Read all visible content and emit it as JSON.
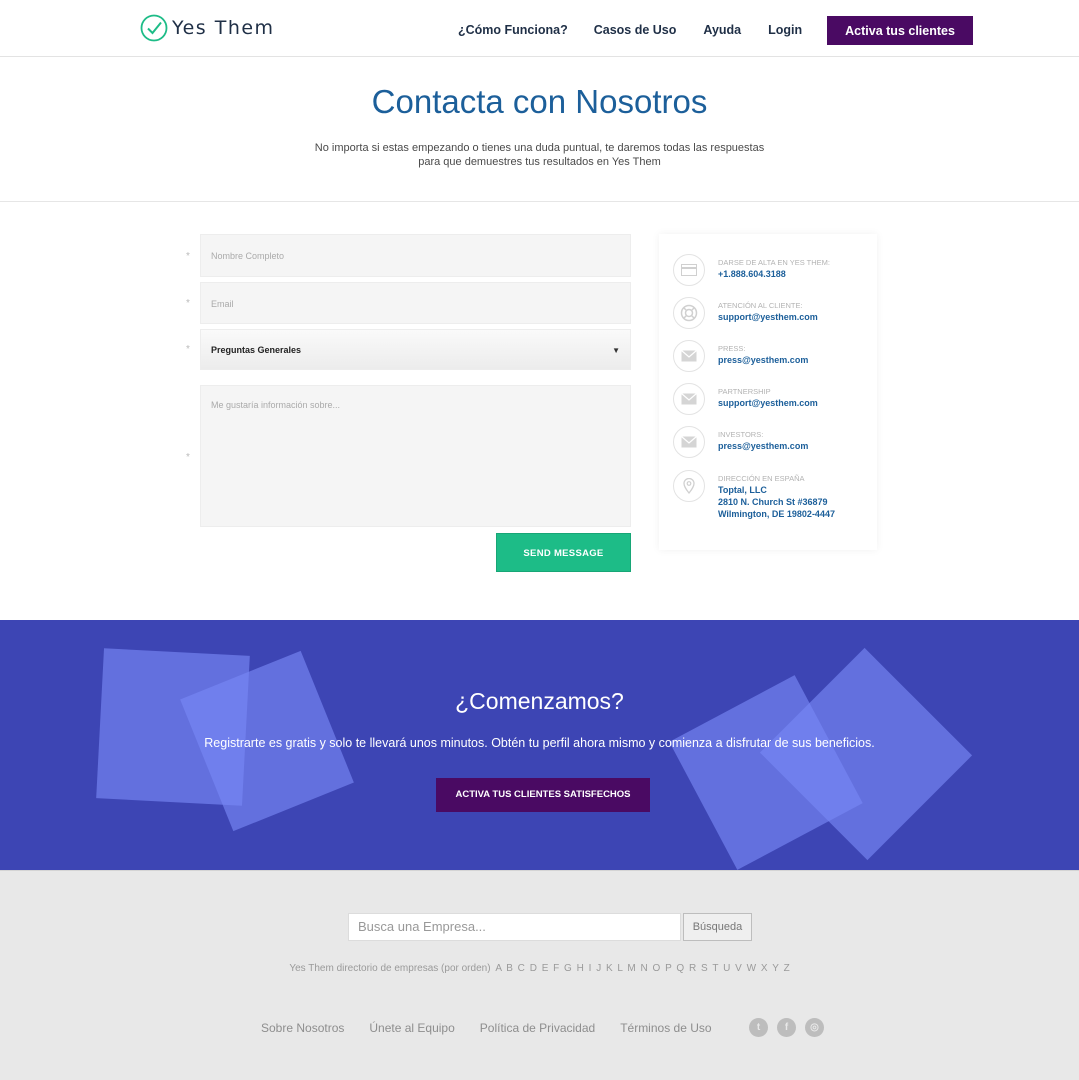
{
  "header": {
    "brand": "Yes Them",
    "nav": {
      "how": "¿Cómo Funciona?",
      "cases": "Casos de Uso",
      "help": "Ayuda",
      "login": "Login",
      "cta": "Activa tus clientes"
    }
  },
  "intro": {
    "title": "Contacta con Nosotros",
    "line1": "No importa si estas empezando o tienes una duda puntual, te daremos todas las respuestas",
    "line2": "para que demuestres tus resultados en Yes Them"
  },
  "form": {
    "required_mark": "*",
    "name_placeholder": "Nombre Completo",
    "email_placeholder": "Email",
    "topic_value": "Preguntas Generales",
    "message_placeholder": "Me gustaría información sobre...",
    "send_label": "SEND MESSAGE"
  },
  "contact": [
    {
      "icon": "card-icon",
      "label": "DARSE DE ALTA EN YES THEM:",
      "value": "+1.888.604.3188"
    },
    {
      "icon": "lifebuoy-icon",
      "label": "ATENCIÓN AL CLIENTE:",
      "value": "support@yesthem.com"
    },
    {
      "icon": "mail-icon",
      "label": "PRESS:",
      "value": "press@yesthem.com"
    },
    {
      "icon": "mail-icon",
      "label": "PARTNERSHIP",
      "value": "support@yesthem.com"
    },
    {
      "icon": "mail-icon",
      "label": "INVESTORS:",
      "value": "press@yesthem.com"
    },
    {
      "icon": "location-pin-icon",
      "label": "DIRECCIÓN EN ESPAÑA",
      "value_lines": [
        "Toptal, LLC",
        "2810 N. Church St #36879",
        "Wilmington, DE 19802-4447"
      ]
    }
  ],
  "cta": {
    "title": "¿Comenzamos?",
    "subtitle": "Registrarte es gratis y solo te llevará unos minutos. Obtén tu perfil ahora mismo y comienza a disfrutar de sus beneficios.",
    "button": "ACTIVA TUS CLIENTES SATISFECHOS"
  },
  "footer": {
    "search_placeholder": "Busca una Empresa...",
    "search_button": "Búsqueda",
    "directory_label": "Yes Them directorio de empresas (por orden)",
    "letters": [
      "A",
      "B",
      "C",
      "D",
      "E",
      "F",
      "G",
      "H",
      "I",
      "J",
      "K",
      "L",
      "M",
      "N",
      "O",
      "P",
      "Q",
      "R",
      "S",
      "T",
      "U",
      "V",
      "W",
      "X",
      "Y",
      "Z"
    ],
    "links": [
      "Sobre Nosotros",
      "Únete al Equipo",
      "Política de Privacidad",
      "Términos de Uso"
    ],
    "social": [
      "twitter-icon",
      "facebook-icon",
      "instagram-icon"
    ]
  },
  "colors": {
    "brand_purple": "#4a0a63",
    "brand_blue": "#1c5f9a",
    "cta_band": "#3d45b4",
    "send_green": "#1dbc87"
  }
}
